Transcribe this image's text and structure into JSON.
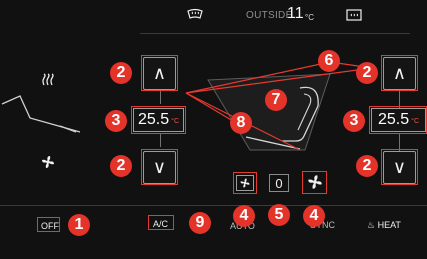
{
  "header": {
    "front_defrost_icon": "front-defrost-icon",
    "outside_label": "OUTSIDE",
    "outside_temp": "11",
    "outside_unit": "°C",
    "rear_defrost_icon": "rear-defrost-icon"
  },
  "left_zone": {
    "heat_icon": "heat-icon",
    "fan_icon": "fan-icon",
    "temp": "25.5",
    "temp_unit": "°C",
    "up_arrow": "∧",
    "down_arrow": "∨"
  },
  "right_zone": {
    "temp": "25.5",
    "temp_unit": "°C",
    "up_arrow": "∧",
    "down_arrow": "∨"
  },
  "fan": {
    "level": "0",
    "decrease_icon": "fan-small-icon",
    "increase_icon": "fan-large-icon"
  },
  "bottom": {
    "off": "OFF",
    "ac": "A/C",
    "auto": "AUTO",
    "sync": "SYNC",
    "heat": "HEAT"
  },
  "markers": {
    "m1": "1",
    "m2a": "2",
    "m2b": "2",
    "m2c": "2",
    "m2d": "2",
    "m3a": "3",
    "m3b": "3",
    "m4a": "4",
    "m4b": "4",
    "m5": "5",
    "m6": "6",
    "m7": "7",
    "m8": "8",
    "m9": "9"
  },
  "colors": {
    "accent_red": "#e4342a",
    "button_border": "#9c9c9c",
    "background": "#111111"
  }
}
